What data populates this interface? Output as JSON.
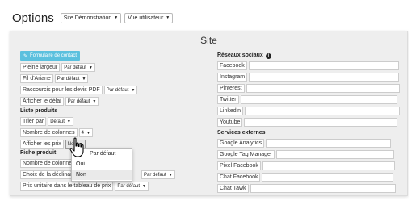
{
  "header": {
    "title": "Options",
    "site_select": "Site Démonstration",
    "view_select": "Vue utilisateur"
  },
  "panel": {
    "title": "Site",
    "contact_button": "Formulaire de contact"
  },
  "left": {
    "rows": [
      {
        "label": "Pleine largeur",
        "value": "Par défaut"
      },
      {
        "label": "Fil d'Ariane",
        "value": "Par défaut"
      },
      {
        "label": "Raccourcis pour les devis PDF",
        "value": "Par défaut"
      },
      {
        "label": "Afficher le délai",
        "value": "Par défaut"
      }
    ],
    "section_products": "Liste produits",
    "products_rows": [
      {
        "label": "Trier par",
        "value": "Défaut"
      },
      {
        "label": "Nombre de colonnes",
        "value": "4"
      },
      {
        "label": "Afficher les prix",
        "value": "Non"
      }
    ],
    "section_product": "Fiche produit",
    "product_rows": [
      {
        "label": "Nombre de colonnes",
        "value": ""
      },
      {
        "label": "Choix de la déclinaison",
        "value": "Par défaut"
      },
      {
        "label": "Prix unitaire dans le tableau de prix",
        "value": "Par défaut"
      }
    ],
    "dropdown": {
      "options": [
        "Par défaut",
        "Oui",
        "Non"
      ]
    }
  },
  "right": {
    "section_social": "Réseaux sociaux",
    "social": [
      "Facebook",
      "Instagram",
      "Pinterest",
      "Twitter",
      "Linkedin",
      "Youtube"
    ],
    "section_external": "Services externes",
    "external": [
      "Google Analytics",
      "Google Tag Manager",
      "Pixel Facebook",
      "Chat Facebook",
      "Chat Tawk"
    ]
  },
  "icons": {
    "info": "info-icon",
    "edit": "edit-icon",
    "cursor": "hand-pointer-icon"
  },
  "colors": {
    "accent": "#5bc0de",
    "panel_bg": "#eeeeee"
  }
}
